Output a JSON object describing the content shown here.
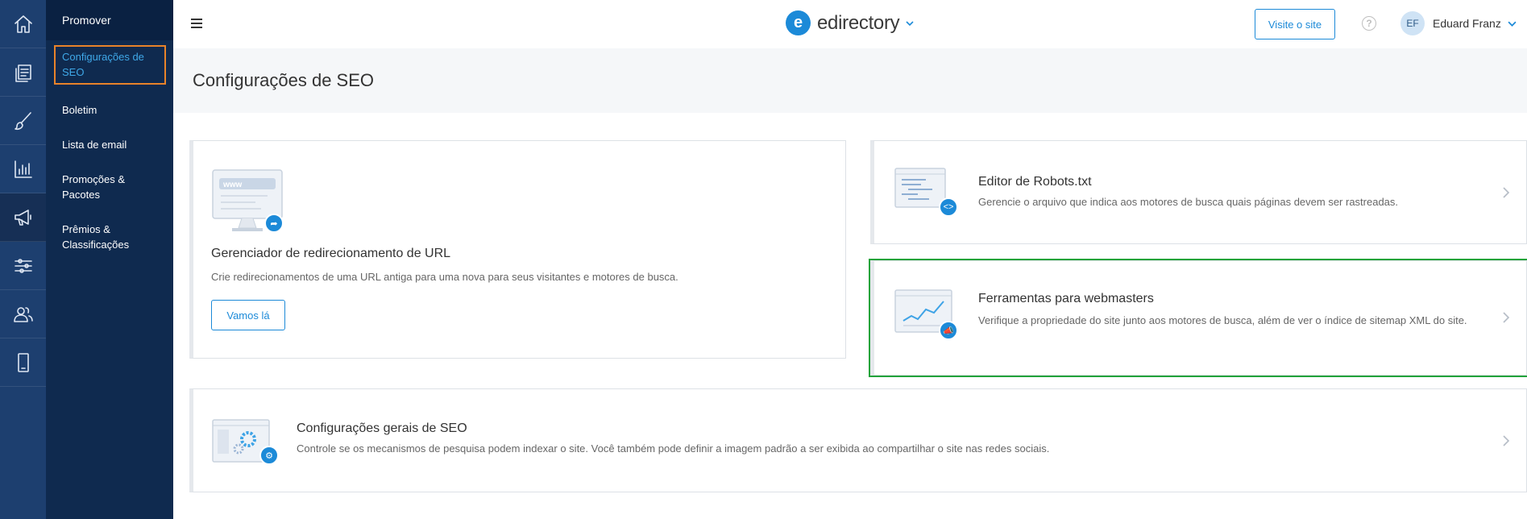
{
  "rail": {
    "items": [
      {
        "icon": "home-icon"
      },
      {
        "icon": "content-icon"
      },
      {
        "icon": "design-brush-icon"
      },
      {
        "icon": "reports-chart-icon"
      },
      {
        "icon": "promote-megaphone-icon",
        "active": true
      },
      {
        "icon": "settings-sliders-icon"
      },
      {
        "icon": "users-icon"
      },
      {
        "icon": "mobile-icon"
      }
    ]
  },
  "submenu": {
    "header": "Promover",
    "items": [
      {
        "label": "Configurações de SEO",
        "active": true
      },
      {
        "label": "Boletim"
      },
      {
        "label": "Lista de email"
      },
      {
        "label": "Promoções & Pacotes"
      },
      {
        "label": "Prêmios & Classificações"
      }
    ]
  },
  "topbar": {
    "logo_mark": "e",
    "logo_text": "edirectory",
    "visit_label": "Visite o site",
    "help_label": "?",
    "user_initials": "EF",
    "user_name": "Eduard Franz"
  },
  "page": {
    "title": "Configurações de SEO"
  },
  "cards": {
    "url": {
      "title": "Gerenciador de redirecionamento de URL",
      "desc": "Crie redirecionamentos de uma URL antiga para uma nova para seus visitantes e motores de busca.",
      "button": "Vamos lá",
      "illus_text": "www"
    },
    "robots": {
      "title": "Editor de Robots.txt",
      "desc": "Gerencie o arquivo que indica aos motores de busca quais páginas devem ser rastreadas."
    },
    "webmaster": {
      "title": "Ferramentas para webmasters",
      "desc": "Verifique a propriedade do site junto aos motores de busca, além de ver o índice de sitemap XML do site."
    },
    "general": {
      "title": "Configurações gerais de SEO",
      "desc": "Controle se os mecanismos de pesquisa podem indexar o site. Você também pode definir a imagem padrão a ser exibida ao compartilhar o site nas redes sociais."
    }
  },
  "colors": {
    "accent": "#1c8ad8",
    "rail_bg": "#1d3f6f",
    "submenu_bg": "#0f2a4f",
    "active_highlight": "#e8832a",
    "webmaster_highlight": "#22a33a"
  }
}
